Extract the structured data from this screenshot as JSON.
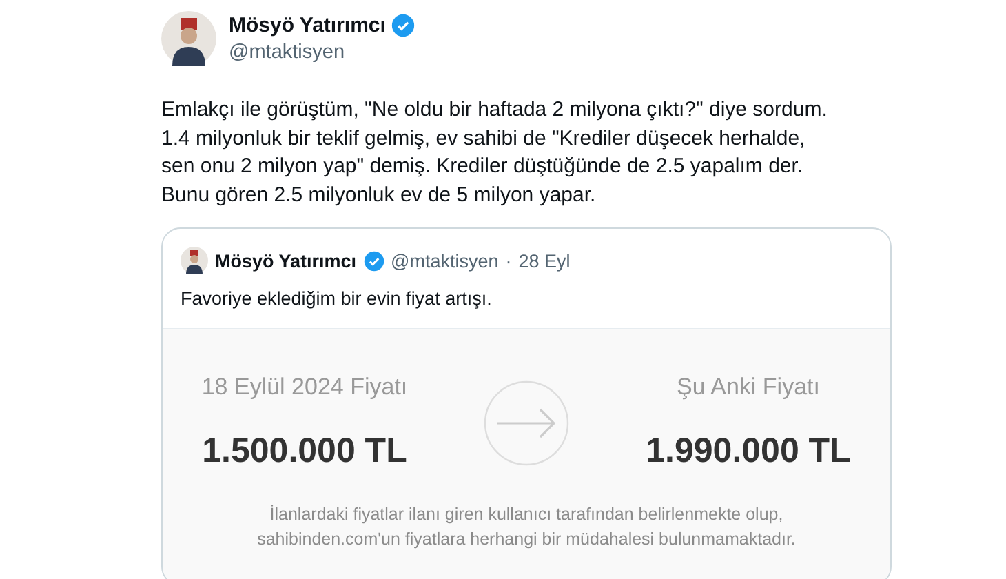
{
  "tweet": {
    "author": {
      "name": "Mösyö Yatırımcı",
      "handle": "@mtaktisyen",
      "verified": true
    },
    "text_lines": [
      "Emlakçı ile görüştüm, \"Ne oldu bir haftada 2 milyona çıktı?\" diye sordum.",
      "1.4 milyonluk bir teklif gelmiş, ev sahibi de \"Krediler düşecek herhalde,",
      "sen onu 2 milyon yap\" demiş. Krediler düştüğünde de 2.5 yapalım der.",
      "Bunu gören 2.5 milyonluk ev de 5 milyon yapar."
    ],
    "quote": {
      "author": {
        "name": "Mösyö Yatırımcı",
        "handle": "@mtaktisyen",
        "verified": true
      },
      "separator": "·",
      "date": "28 Eyl",
      "text": "Favoriye eklediğim bir evin fiyat artışı.",
      "card": {
        "before": {
          "label": "18 Eylül 2024 Fiyatı",
          "price": "1.500.000 TL"
        },
        "after": {
          "label": "Şu Anki Fiyatı",
          "price": "1.990.000 TL"
        },
        "disclaimer_lines": [
          "İlanlardaki fiyatlar ilanı giren kullanıcı tarafından belirlenmekte olup,",
          "sahibinden.com'un fiyatlara herhangi bir müdahalesi bulunmamaktadır."
        ]
      }
    }
  }
}
